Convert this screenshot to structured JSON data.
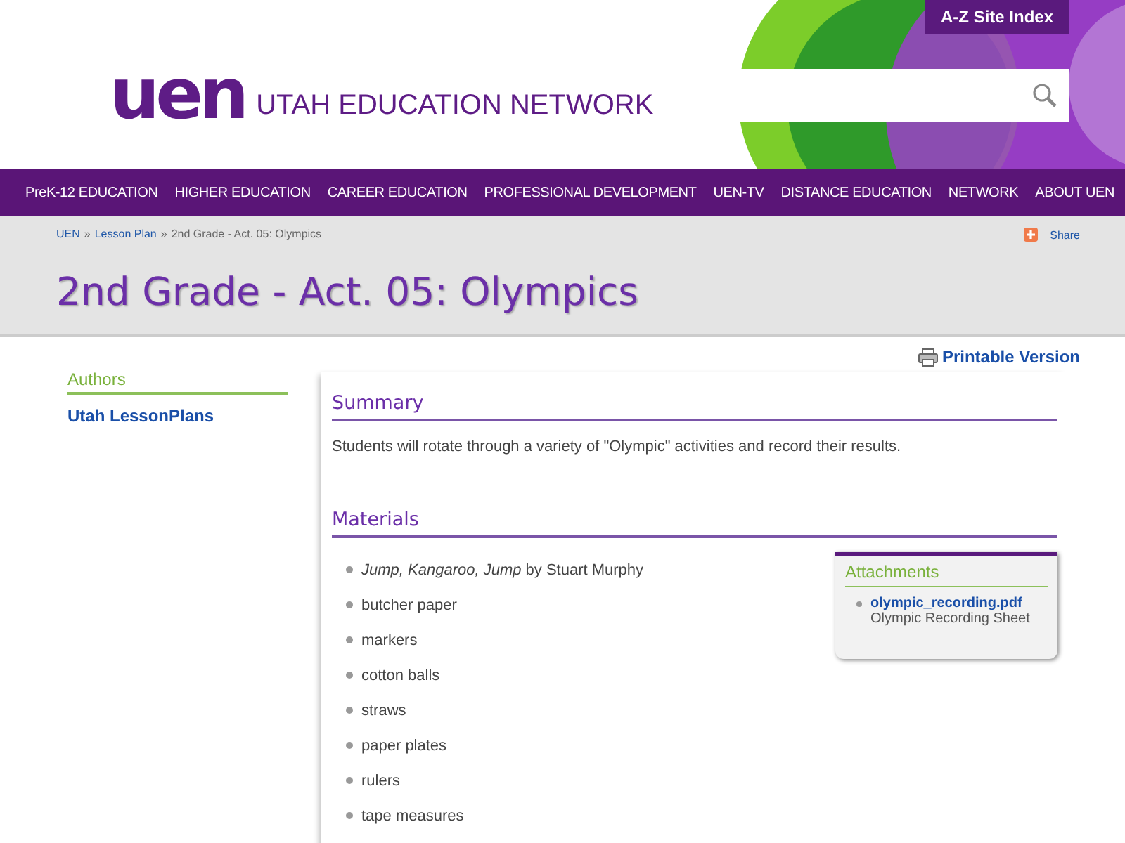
{
  "header": {
    "logo": "uen",
    "site_name": "UTAH EDUCATION NETWORK",
    "site_index_button": "A-Z Site Index"
  },
  "nav": [
    "PreK-12 EDUCATION",
    "HIGHER EDUCATION",
    "CAREER EDUCATION",
    "PROFESSIONAL DEVELOPMENT",
    "UEN-TV",
    "DISTANCE EDUCATION",
    "NETWORK",
    "ABOUT UEN"
  ],
  "breadcrumb": [
    {
      "label": "UEN",
      "link": true
    },
    {
      "label": "»",
      "link": false
    },
    {
      "label": "Lesson Plan",
      "link": true
    },
    {
      "label": "»",
      "link": false
    },
    {
      "label": "2nd Grade - Act. 05: Olympics",
      "link": false
    }
  ],
  "share": "Share",
  "page_title": "2nd Grade - Act. 05: Olympics",
  "sidebar": {
    "heading": "Authors",
    "authors": [
      "Utah LessonPlans"
    ]
  },
  "printable_version": "Printable Version",
  "summary": {
    "heading": "Summary",
    "text": "Students will rotate through a variety of \"Olympic\" activities and record their results."
  },
  "materials": {
    "heading": "Materials",
    "items": [
      "*Jump, Kangaroo, Jump* by Stuart Murphy",
      "butcher paper",
      "markers",
      "cotton balls",
      "straws",
      "paper plates",
      "rulers",
      "tape measures"
    ]
  },
  "attachments": {
    "heading": "Attachments",
    "files": [
      {
        "name": "olympic_recording.pdf",
        "description": "Olympic Recording Sheet"
      }
    ]
  }
}
